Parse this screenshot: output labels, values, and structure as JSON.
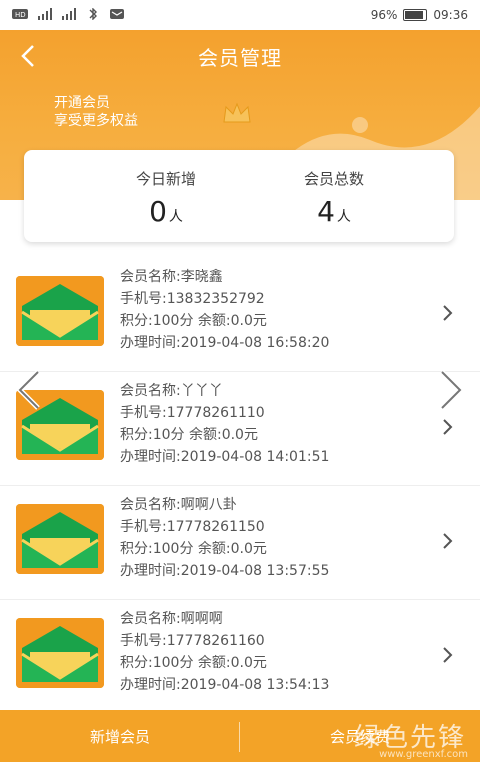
{
  "status_bar": {
    "battery": "96%",
    "time": "09:36"
  },
  "header": {
    "title": "会员管理",
    "promo_line1": "开通会员",
    "promo_line2": "享受更多权益"
  },
  "stats": {
    "today_label": "今日新增",
    "today_value": "0",
    "today_unit": "人",
    "total_label": "会员总数",
    "total_value": "4",
    "total_unit": "人"
  },
  "members": [
    {
      "name": "会员名称:李晓鑫",
      "phone": "手机号:13832352792",
      "points_balance": "积分:100分    余额:0.0元",
      "time": "办理时间:2019-04-08 16:58:20"
    },
    {
      "name": "会员名称:丫丫丫",
      "phone": "手机号:17778261110",
      "points_balance": "积分:10分    余额:0.0元",
      "time": "办理时间:2019-04-08 14:01:51"
    },
    {
      "name": "会员名称:啊啊八卦",
      "phone": "手机号:17778261150",
      "points_balance": "积分:100分    余额:0.0元",
      "time": "办理时间:2019-04-08 13:57:55"
    },
    {
      "name": "会员名称:啊啊啊",
      "phone": "手机号:17778261160",
      "points_balance": "积分:100分    余额:0.0元",
      "time": "办理时间:2019-04-08 13:54:13"
    }
  ],
  "bottom": {
    "add_member": "新增会员",
    "renew": "会员续费"
  },
  "watermark": {
    "text": "绿色先锋",
    "url": "www.greenxf.com"
  },
  "colors": {
    "accent": "#f4a12e",
    "avatar_green": "#1aa34a"
  }
}
